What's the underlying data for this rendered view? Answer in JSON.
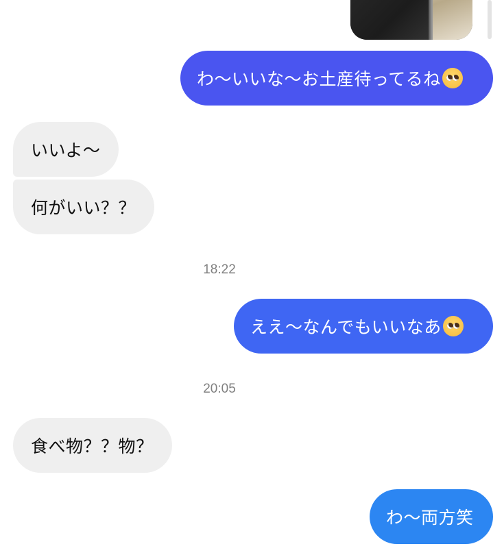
{
  "thread": {
    "messages": [
      {
        "side": "out",
        "text": "わ〜いいな〜お土産待ってるね",
        "emoji": "pleading-face",
        "color": "#4a55f0"
      },
      {
        "side": "in",
        "text": "いいよ〜"
      },
      {
        "side": "in",
        "text": "何がいい？？"
      },
      {
        "time": "18:22"
      },
      {
        "side": "out",
        "text": "ええ〜なんでもいいなあ",
        "emoji": "pleading-face",
        "color": "#3f66f3"
      },
      {
        "time": "20:05"
      },
      {
        "side": "in",
        "text": "食べ物？？物？"
      },
      {
        "side": "out",
        "text": "わ〜両方笑",
        "color": "#2c86f2"
      }
    ]
  }
}
